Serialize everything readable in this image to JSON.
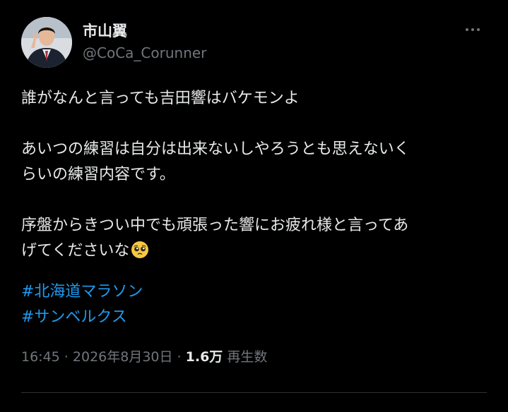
{
  "user": {
    "display_name": "市山翼",
    "handle": "@CoCa_Corunner"
  },
  "menu": {
    "more_icon": "more-horizontal-icon"
  },
  "tweet": {
    "line1": "誰がなんと言っても吉田響はバケモンよ",
    "line2a": "あいつの練習は自分は出来ないしやろうとも思えないく",
    "line2b": "らいの練習内容です。",
    "line3a": "序盤からきつい中でも頑張った響にお疲れ様と言ってあ",
    "line3b": "げてくださいな",
    "emoji": "pleading-face-emoji",
    "hashtags": [
      "#北海道マラソン",
      "#サンベルクス"
    ]
  },
  "meta": {
    "time": "16:45",
    "sep1": " · ",
    "date": "2026年8月30日",
    "sep2": " · ",
    "views_count": "1.6万",
    "views_label": "再生数"
  },
  "colors": {
    "background": "#000000",
    "text": "#e7e9ea",
    "secondary": "#71767b",
    "link": "#1d9bf0",
    "divider": "#2f3336"
  }
}
